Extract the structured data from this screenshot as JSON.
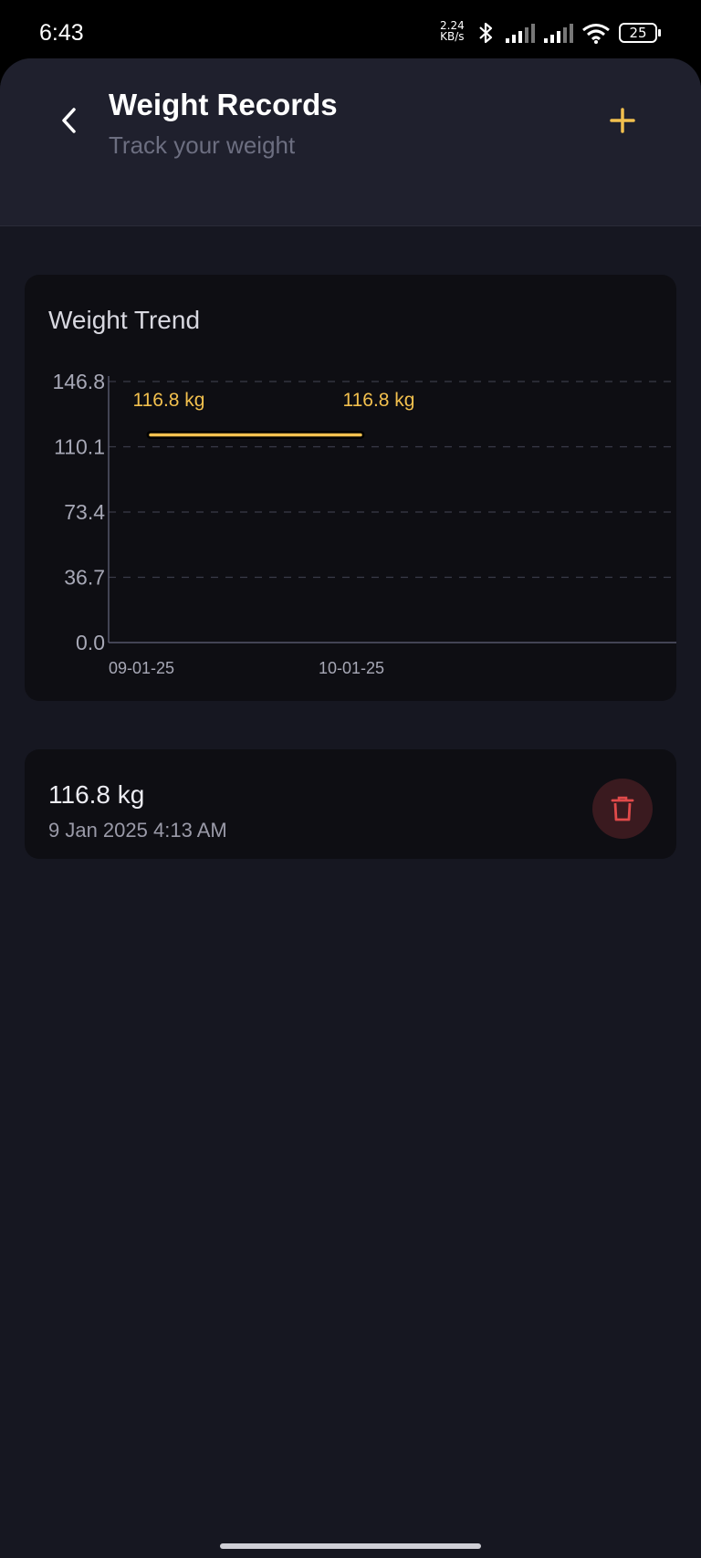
{
  "status_bar": {
    "time": "6:43",
    "net_speed_value": "2.24",
    "net_speed_unit": "KB/s",
    "battery": "25",
    "icons": [
      "bluetooth-icon",
      "signal-icon",
      "signal-icon",
      "wifi-icon",
      "battery-icon"
    ]
  },
  "header": {
    "title": "Weight Records",
    "subtitle": "Track your weight",
    "back_icon": "chevron-left-icon",
    "add_icon": "plus-icon"
  },
  "colors": {
    "accent": "#f2c04e",
    "background": "#161721",
    "header_bg": "#1f202d",
    "card_bg": "#0e0e13",
    "delete": "#e04a4a"
  },
  "chart": {
    "title": "Weight Trend"
  },
  "chart_data": {
    "type": "line",
    "title": "Weight Trend",
    "x": [
      "09-01-25",
      "10-01-25"
    ],
    "series": [
      {
        "values": [
          116.8,
          116.8
        ]
      }
    ],
    "data_labels": [
      "116.8 kg",
      "116.8 kg"
    ],
    "y_ticks": [
      "0.0",
      "36.7",
      "73.4",
      "110.1",
      "146.8"
    ],
    "ylim": [
      0,
      146.8
    ],
    "grid": "horizontal-dashed",
    "xlabel": "",
    "ylabel": ""
  },
  "records": [
    {
      "weight": "116.8 kg",
      "date": "9 Jan 2025 4:13 AM",
      "delete_icon": "trash-icon"
    }
  ]
}
